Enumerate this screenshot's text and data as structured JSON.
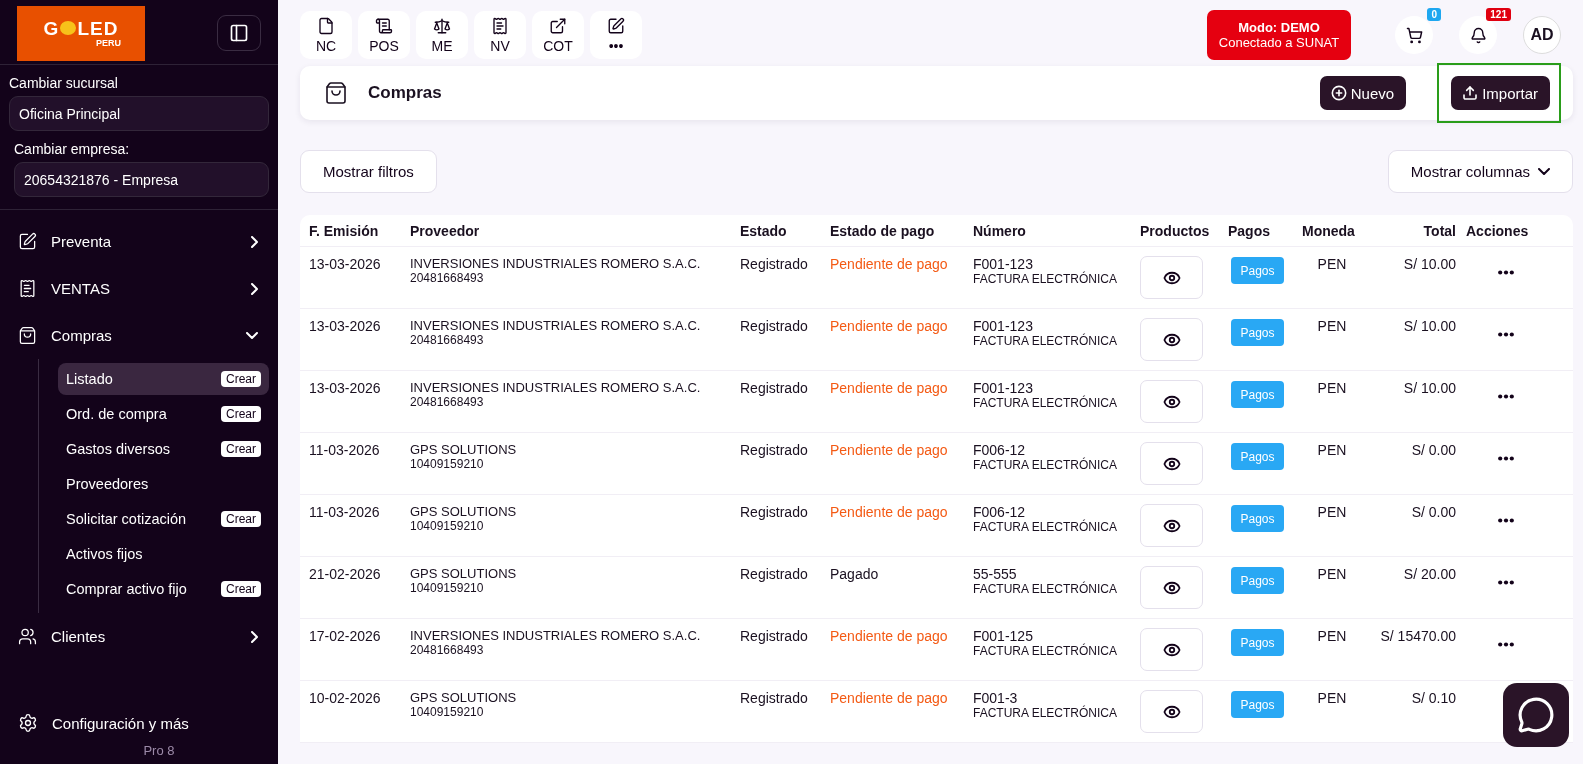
{
  "sidebar": {
    "logo": {
      "left": "G",
      "right": "LED",
      "sub": "PERU"
    },
    "branch": {
      "label": "Cambiar sucursal",
      "value": "Oficina Principal"
    },
    "company": {
      "label": "Cambiar empresa:",
      "value": "20654321876 - Empresa"
    },
    "nav": [
      {
        "label": "Preventa",
        "expanded": false
      },
      {
        "label": "VENTAS",
        "expanded": false
      },
      {
        "label": "Compras",
        "expanded": true,
        "children": [
          {
            "label": "Listado",
            "selected": true,
            "action": "Crear"
          },
          {
            "label": "Ord. de compra",
            "selected": false,
            "action": "Crear"
          },
          {
            "label": "Gastos diversos",
            "selected": false,
            "action": "Crear"
          },
          {
            "label": "Proveedores",
            "selected": false
          },
          {
            "label": "Solicitar cotización",
            "selected": false,
            "action": "Crear"
          },
          {
            "label": "Activos fijos",
            "selected": false
          },
          {
            "label": "Comprar activo fijo",
            "selected": false,
            "action": "Crear"
          }
        ]
      },
      {
        "label": "Clientes",
        "expanded": false
      }
    ],
    "settings": "Configuración y más",
    "version": "Pro 8"
  },
  "shortcuts": [
    {
      "label": "NC"
    },
    {
      "label": "POS"
    },
    {
      "label": "ME"
    },
    {
      "label": "NV"
    },
    {
      "label": "COT"
    },
    {
      "label": "•••"
    }
  ],
  "mode_badge": {
    "title": "Modo: DEMO",
    "subtitle": "Conectado a SUNAT"
  },
  "cart_count": "0",
  "notification_count": "121",
  "avatar": "AD",
  "page": {
    "title": "Compras",
    "buttons": [
      {
        "label": "Nuevo",
        "highlighted": false
      },
      {
        "label": "Importar",
        "highlighted": true
      }
    ]
  },
  "filters_button": "Mostrar filtros",
  "columns_button": "Mostrar columnas",
  "table": {
    "columns": [
      "F. Emisión",
      "Proveedor",
      "Estado",
      "Estado de pago",
      "Número",
      "Productos",
      "Pagos",
      "Moneda",
      "Total",
      "Acciones"
    ],
    "rows": [
      {
        "date": "13-03-2026",
        "supplier": "INVERSIONES INDUSTRIALES ROMERO S.A.C.",
        "ruc": "20481668493",
        "status": "Registrado",
        "payment": "Pendiente de pago",
        "pending": true,
        "number": "F001-123",
        "doc_type": "FACTURA ELECTRÓNICA",
        "pay_button": "Pagos",
        "currency": "PEN",
        "total": "S/ 10.00",
        "menu_visible": true
      },
      {
        "date": "13-03-2026",
        "supplier": "INVERSIONES INDUSTRIALES ROMERO S.A.C.",
        "ruc": "20481668493",
        "status": "Registrado",
        "payment": "Pendiente de pago",
        "pending": true,
        "number": "F001-123",
        "doc_type": "FACTURA ELECTRÓNICA",
        "pay_button": "Pagos",
        "currency": "PEN",
        "total": "S/ 10.00",
        "menu_visible": true
      },
      {
        "date": "13-03-2026",
        "supplier": "INVERSIONES INDUSTRIALES ROMERO S.A.C.",
        "ruc": "20481668493",
        "status": "Registrado",
        "payment": "Pendiente de pago",
        "pending": true,
        "number": "F001-123",
        "doc_type": "FACTURA ELECTRÓNICA",
        "pay_button": "Pagos",
        "currency": "PEN",
        "total": "S/ 10.00",
        "menu_visible": true
      },
      {
        "date": "11-03-2026",
        "supplier": "GPS SOLUTIONS",
        "ruc": "10409159210",
        "status": "Registrado",
        "payment": "Pendiente de pago",
        "pending": true,
        "number": "F006-12",
        "doc_type": "FACTURA ELECTRÓNICA",
        "pay_button": "Pagos",
        "currency": "PEN",
        "total": "S/ 0.00",
        "menu_visible": true
      },
      {
        "date": "11-03-2026",
        "supplier": "GPS SOLUTIONS",
        "ruc": "10409159210",
        "status": "Registrado",
        "payment": "Pendiente de pago",
        "pending": true,
        "number": "F006-12",
        "doc_type": "FACTURA ELECTRÓNICA",
        "pay_button": "Pagos",
        "currency": "PEN",
        "total": "S/ 0.00",
        "menu_visible": true
      },
      {
        "date": "21-02-2026",
        "supplier": "GPS SOLUTIONS",
        "ruc": "10409159210",
        "status": "Registrado",
        "payment": "Pagado",
        "pending": false,
        "number": "55-555",
        "doc_type": "FACTURA ELECTRÓNICA",
        "pay_button": "Pagos",
        "currency": "PEN",
        "total": "S/ 20.00",
        "menu_visible": true
      },
      {
        "date": "17-02-2026",
        "supplier": "INVERSIONES INDUSTRIALES ROMERO S.A.C.",
        "ruc": "20481668493",
        "status": "Registrado",
        "payment": "Pendiente de pago",
        "pending": true,
        "number": "F001-125",
        "doc_type": "FACTURA ELECTRÓNICA",
        "pay_button": "Pagos",
        "currency": "PEN",
        "total": "S/ 15470.00",
        "menu_visible": true
      },
      {
        "date": "10-02-2026",
        "supplier": "GPS SOLUTIONS",
        "ruc": "10409159210",
        "status": "Registrado",
        "payment": "Pendiente de pago",
        "pending": true,
        "number": "F001-3",
        "doc_type": "FACTURA ELECTRÓNICA",
        "pay_button": "Pagos",
        "currency": "PEN",
        "total": "S/ 0.10",
        "menu_visible": false
      }
    ]
  }
}
